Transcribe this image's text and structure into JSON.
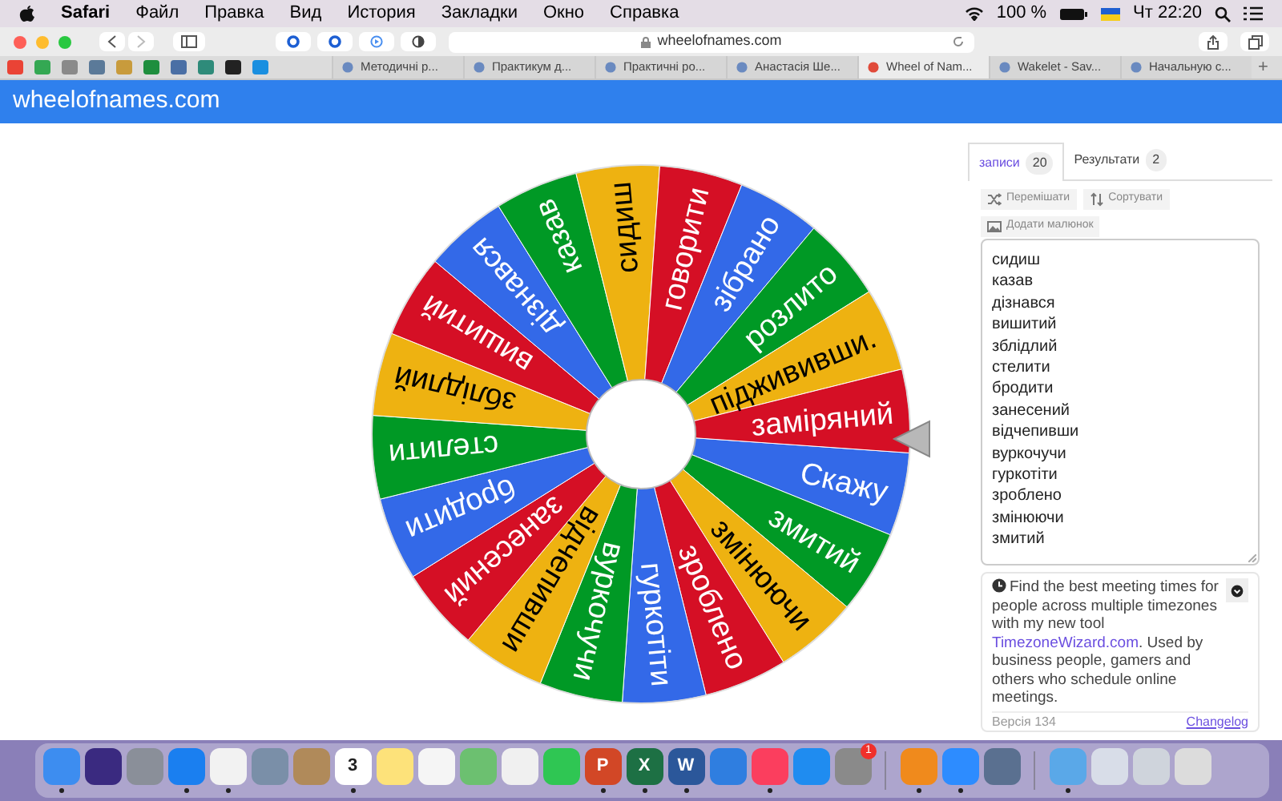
{
  "menu_bar": {
    "app": "Safari",
    "items": [
      "Файл",
      "Правка",
      "Вид",
      "История",
      "Закладки",
      "Окно",
      "Справка"
    ],
    "battery": "100 %",
    "clock": "Чт 22:20"
  },
  "toolbar": {
    "address": "wheelofnames.com"
  },
  "tabs": [
    {
      "label": "Методичні р...",
      "selected": false
    },
    {
      "label": "Практикум д...",
      "selected": false
    },
    {
      "label": "Практичні ро...",
      "selected": false
    },
    {
      "label": "Анастасія Ше...",
      "selected": false
    },
    {
      "label": "Wheel of Nam...",
      "selected": true
    },
    {
      "label": "Wakelet - Sav...",
      "selected": false
    },
    {
      "label": "Начальную с...",
      "selected": false
    }
  ],
  "new_tab": "+",
  "site": {
    "title": "wheelofnames.com"
  },
  "wheel": {
    "segments": [
      {
        "label": "Скажу",
        "color": "#3369e8"
      },
      {
        "label": "змитий",
        "color": "#009925"
      },
      {
        "label": "змінюючи",
        "color": "#eeb211"
      },
      {
        "label": "зроблено",
        "color": "#d50f25"
      },
      {
        "label": "гуркотіти",
        "color": "#3369e8"
      },
      {
        "label": "вуркочучи",
        "color": "#009925"
      },
      {
        "label": "відчепивши",
        "color": "#eeb211"
      },
      {
        "label": "занесений",
        "color": "#d50f25"
      },
      {
        "label": "бродити",
        "color": "#3369e8"
      },
      {
        "label": "стелити",
        "color": "#009925"
      },
      {
        "label": "зблідлий",
        "color": "#eeb211"
      },
      {
        "label": "вишитий",
        "color": "#d50f25"
      },
      {
        "label": "дізнався",
        "color": "#3369e8"
      },
      {
        "label": "казав",
        "color": "#009925"
      },
      {
        "label": "сидиш",
        "color": "#eeb211"
      },
      {
        "label": "говорити",
        "color": "#d50f25"
      },
      {
        "label": "зібрано",
        "color": "#3369e8"
      },
      {
        "label": "розлито",
        "color": "#009925"
      },
      {
        "label": "піджививши.",
        "color": "#eeb211"
      },
      {
        "label": "заміряний",
        "color": "#d50f25"
      }
    ]
  },
  "panel": {
    "tabs": [
      {
        "label": "записи",
        "count": "20",
        "selected": true
      },
      {
        "label": "Результати",
        "count": "2",
        "selected": false
      }
    ],
    "buttons": [
      {
        "kind": "shuffle",
        "label": "Перемішати"
      },
      {
        "kind": "sort",
        "label": "Сортувати"
      },
      {
        "kind": "image",
        "label": "Додати малюнок"
      }
    ],
    "entries": [
      "сидиш",
      "казав",
      "дізнався",
      "вишитий",
      "зблідлий",
      "стелити",
      "бродити",
      "занесений",
      "відчепивши",
      "вуркочучи",
      "гуркотіти",
      "зроблено",
      "змінюючи",
      "змитий"
    ],
    "notice": {
      "before": "Find the best meeting times for people across multiple timezones with my new tool",
      "link": "TimezoneWizard.com",
      "after": ". Used by business people, gamers and others who schedule online meetings."
    },
    "version": "Версія 134",
    "changelog": "Changelog"
  },
  "dock": {
    "groups": [
      [
        {
          "running": true
        },
        {
          "running": false
        },
        {
          "running": false
        },
        {
          "running": true
        },
        {
          "running": true
        },
        {
          "running": false
        },
        {
          "running": false
        },
        {
          "running": true,
          "label": "3"
        },
        {
          "running": false
        },
        {
          "running": false
        },
        {
          "running": false
        },
        {
          "running": false
        },
        {
          "running": false
        },
        {
          "running": true,
          "label": "P"
        },
        {
          "running": true,
          "label": "X"
        },
        {
          "running": true,
          "label": "W"
        },
        {
          "running": false
        },
        {
          "running": true
        },
        {
          "running": false
        },
        {
          "running": false,
          "badge": "1"
        }
      ],
      [
        {
          "running": true
        },
        {
          "running": true
        },
        {
          "running": false
        }
      ],
      [
        {
          "running": true
        },
        {
          "running": false
        },
        {
          "running": false
        },
        {
          "running": false
        }
      ]
    ]
  }
}
